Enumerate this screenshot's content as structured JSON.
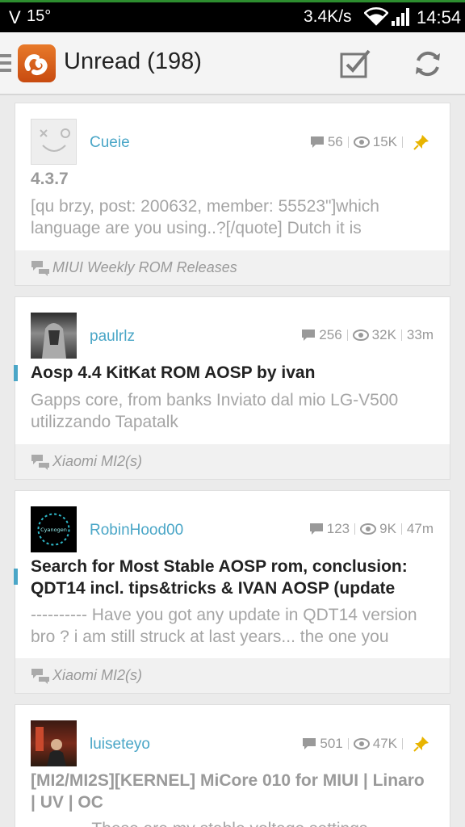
{
  "status_bar": {
    "carrier": "V",
    "temperature": "15°",
    "net_speed": "3.4K/s",
    "time": "14:54"
  },
  "action_bar": {
    "title": "Unread (198)"
  },
  "topics": [
    {
      "author": "Cueie",
      "replies": "56",
      "views": "15K",
      "age": "",
      "pinned": true,
      "title": "4.3.7",
      "snippet_line1": "[qu  brzy, post: 200632, member: 55523\"]which",
      "snippet_line2": "language are you using..?[/quote] Dutch it is",
      "forum": "MIUI Weekly ROM Releases",
      "unread": false
    },
    {
      "author": "paulrlz",
      "replies": "256",
      "views": "32K",
      "age": "33m",
      "pinned": false,
      "title": "Aosp 4.4 KitKat ROM AOSP by ivan",
      "snippet_line1": "Gapps core, from banks  Inviato dal mio LG-V500",
      "snippet_line2": "utilizzando Tapatalk",
      "forum": "Xiaomi MI2(s)",
      "unread": true
    },
    {
      "author": "RobinHood00",
      "replies": "123",
      "views": "9K",
      "age": "47m",
      "pinned": false,
      "title_line1": "Search for Most Stable AOSP rom, conclusion:",
      "title_line2": "QDT14 incl. tips&tricks & IVAN AOSP (update",
      "snippet_line1": "---------- Have you got any update in QDT14 version",
      "snippet_line2": "bro ? i am still struck at last years... the one you",
      "forum": "Xiaomi MI2(s)",
      "unread": true,
      "avatar_text": "Cyanogen"
    },
    {
      "author": "luiseteyo",
      "replies": "501",
      "views": "47K",
      "age": "",
      "pinned": true,
      "title_line1": "[MI2/MI2S][KERNEL] MiCore 010 for MIUI | Linaro",
      "title_line2": "| UV | OC",
      "snippet_line1": "---------- These are my stable voltage settings",
      "unread": false
    }
  ],
  "colors": {
    "accent": "#4aa6c7",
    "pin": "#e8b400",
    "statusbar_line": "#2d8d2f"
  }
}
